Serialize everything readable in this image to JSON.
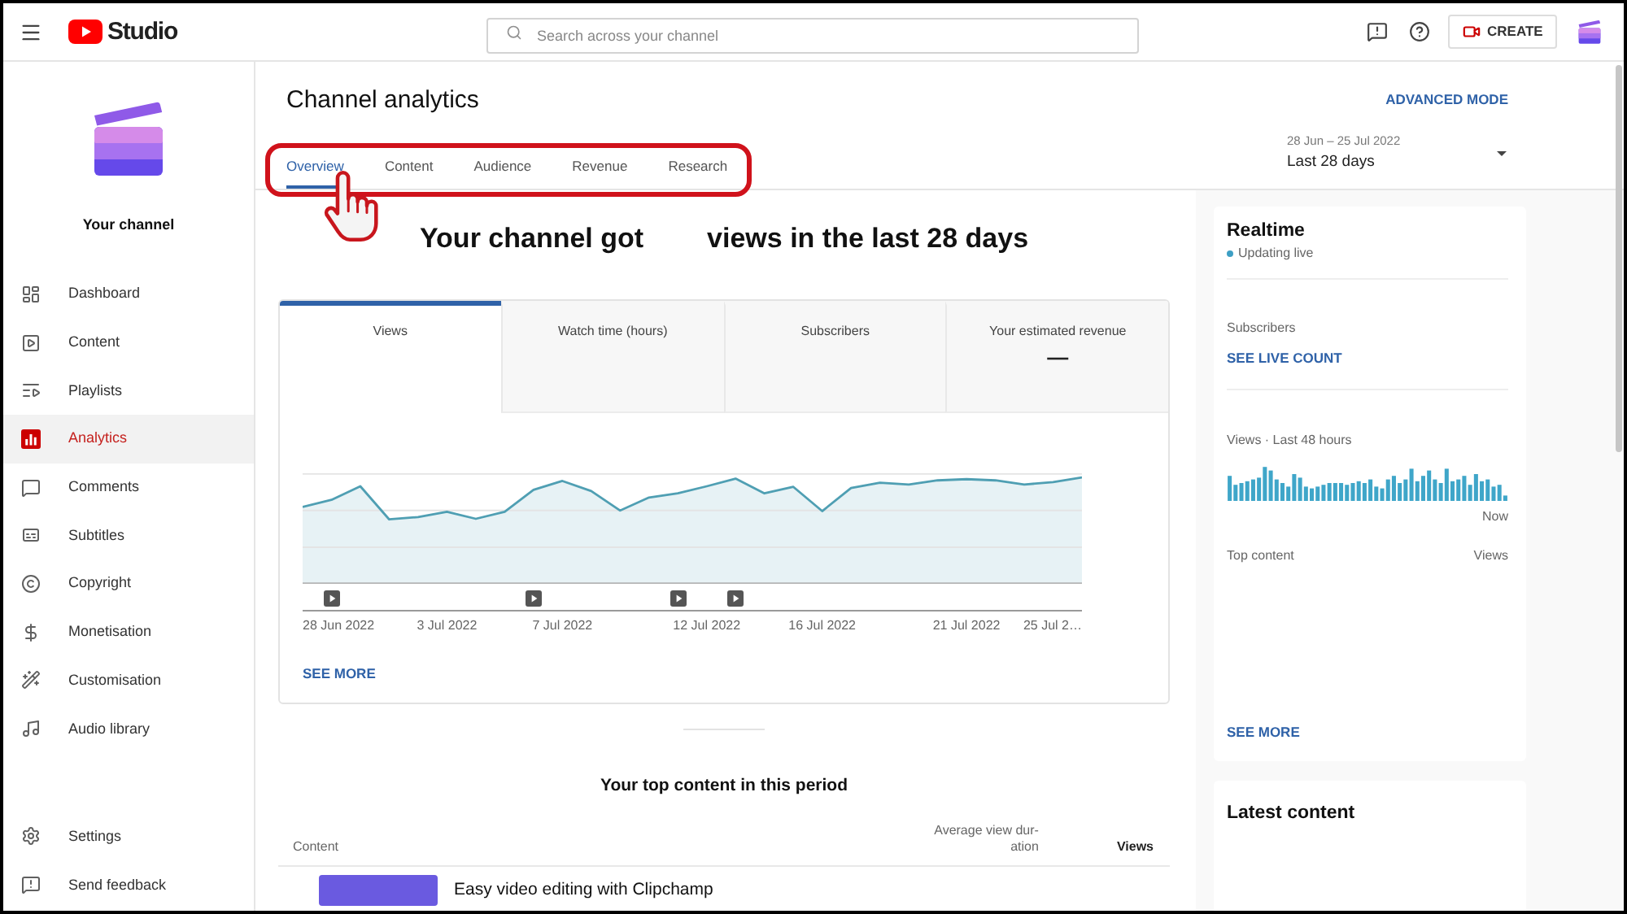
{
  "topbar": {
    "logo_text": "Studio",
    "search": {
      "placeholder": "Search across your channel"
    },
    "create_button": "CREATE"
  },
  "sidebar": {
    "channel_name": "Your channel",
    "items": [
      {
        "label": "Dashboard",
        "selected": false
      },
      {
        "label": "Content",
        "selected": false
      },
      {
        "label": "Playlists",
        "selected": false
      },
      {
        "label": "Analytics",
        "selected": true
      },
      {
        "label": "Comments",
        "selected": false
      },
      {
        "label": "Subtitles",
        "selected": false
      },
      {
        "label": "Copyright",
        "selected": false
      },
      {
        "label": "Monetisation",
        "selected": false
      },
      {
        "label": "Customisation",
        "selected": false
      },
      {
        "label": "Audio library",
        "selected": false
      }
    ],
    "footer_items": [
      {
        "label": "Settings"
      },
      {
        "label": "Send feedback"
      }
    ]
  },
  "header": {
    "title": "Channel analytics",
    "tabs": [
      {
        "label": "Overview",
        "selected": true
      },
      {
        "label": "Content",
        "selected": false
      },
      {
        "label": "Audience",
        "selected": false
      },
      {
        "label": "Revenue",
        "selected": false
      },
      {
        "label": "Research",
        "selected": false
      }
    ],
    "advanced_mode": "ADVANCED MODE",
    "date_range": {
      "range": "28 Jun – 25 Jul 2022",
      "label": "Last 28 days"
    }
  },
  "summary": {
    "headline_start": "Your channel got",
    "headline_end": "views in the last 28 days"
  },
  "metrics": {
    "tabs": [
      {
        "label": "Views",
        "selected": true
      },
      {
        "label": "Watch time (hours)",
        "selected": false
      },
      {
        "label": "Subscribers",
        "selected": false
      },
      {
        "label": "Your estimated revenue",
        "selected": false,
        "value": "—"
      }
    ],
    "x_labels": [
      "28 Jun 2022",
      "3 Jul 2022",
      "7 Jul 2022",
      "12 Jul 2022",
      "16 Jul 2022",
      "21 Jul 2022",
      "25 Jul 2…"
    ],
    "see_more": "SEE MORE"
  },
  "top_content": {
    "title": "Your top content in this period",
    "columns": [
      {
        "label": "Content",
        "sorted": false
      },
      {
        "label": "Average view dur-ation",
        "sorted": false
      },
      {
        "label": "Views",
        "sorted": true
      }
    ],
    "rows": [
      {
        "title": "Easy video editing with Clipchamp"
      }
    ]
  },
  "realtime": {
    "title": "Realtime",
    "status": "Updating live",
    "subscribers_label": "Subscribers",
    "see_live_count": "SEE LIVE COUNT",
    "views_label": "Views · Last 48 hours",
    "now_label": "Now",
    "columns": [
      "Top content",
      "Views"
    ],
    "see_more": "SEE MORE"
  },
  "latest_content": {
    "title": "Latest content"
  }
}
